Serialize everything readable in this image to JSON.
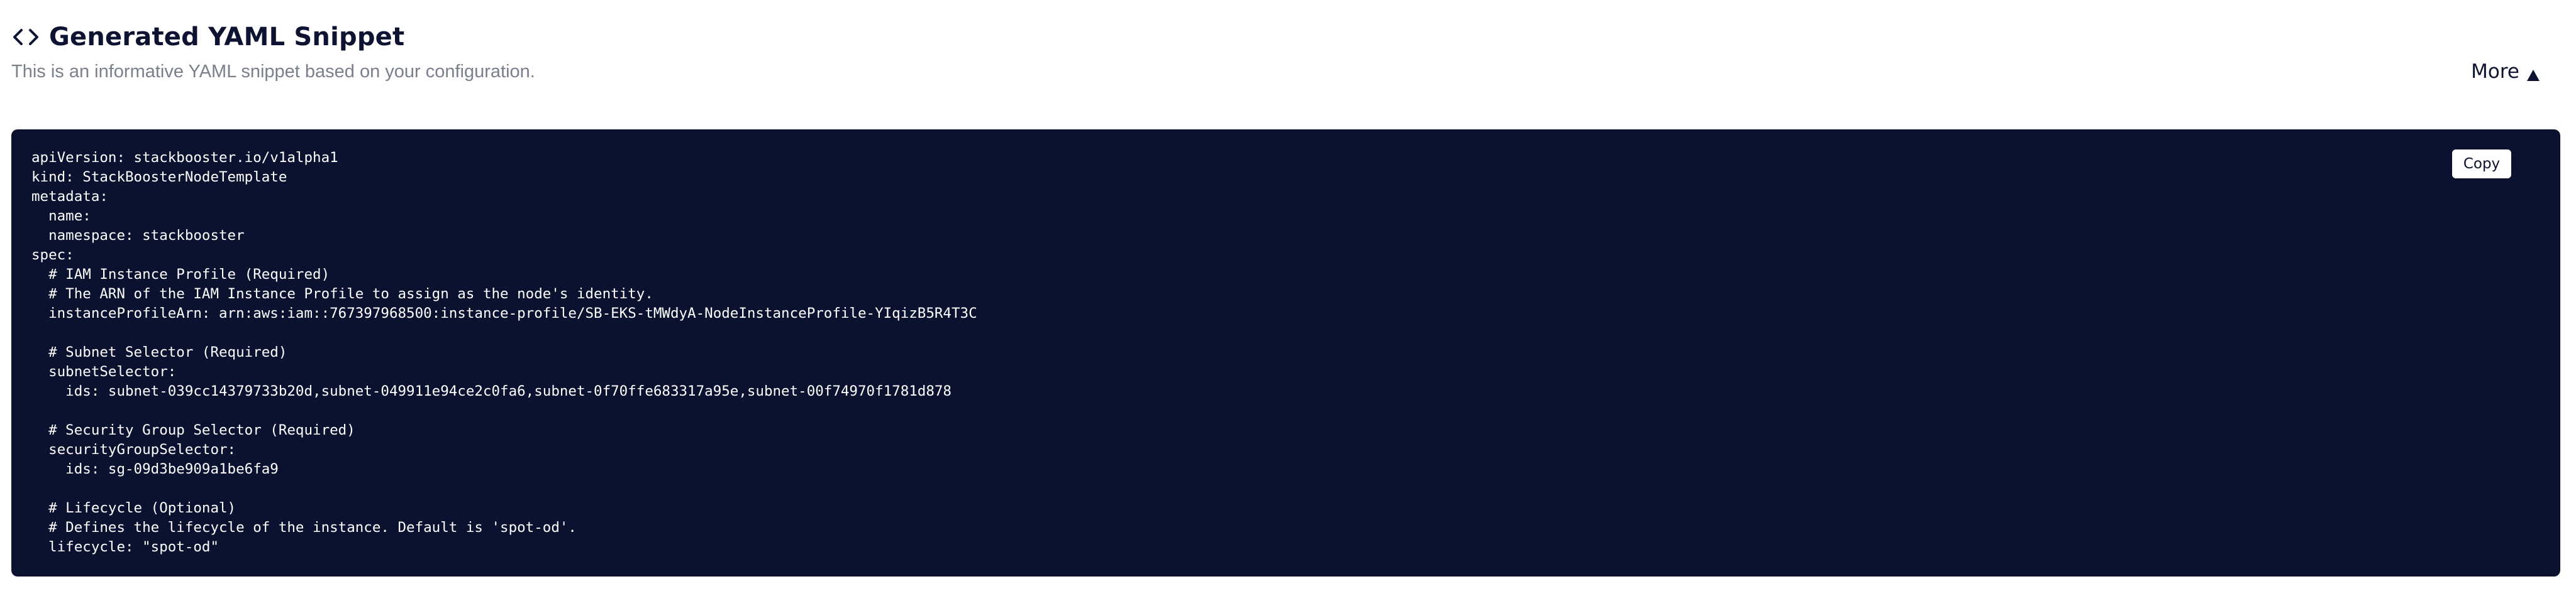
{
  "header": {
    "icon": "code-icon",
    "title": "Generated YAML Snippet",
    "subtitle": "This is an informative YAML snippet based on your configuration."
  },
  "more_toggle": {
    "label": "More",
    "icon": "caret-up-icon"
  },
  "code_panel": {
    "copy_label": "Copy",
    "background": "#0b1230",
    "yaml": "apiVersion: stackbooster.io/v1alpha1\nkind: StackBoosterNodeTemplate\nmetadata:\n  name:\n  namespace: stackbooster\nspec:\n  # IAM Instance Profile (Required)\n  # The ARN of the IAM Instance Profile to assign as the node's identity.\n  instanceProfileArn: arn:aws:iam::767397968500:instance-profile/SB-EKS-tMWdyA-NodeInstanceProfile-YIqizB5R4T3C\n\n  # Subnet Selector (Required)\n  subnetSelector:\n    ids: subnet-039cc14379733b20d,subnet-049911e94ce2c0fa6,subnet-0f70ffe683317a95e,subnet-00f74970f1781d878\n\n  # Security Group Selector (Required)\n  securityGroupSelector:\n    ids: sg-09d3be909a1be6fa9\n\n  # Lifecycle (Optional)\n  # Defines the lifecycle of the instance. Default is 'spot-od'.\n  lifecycle: \"spot-od\""
  }
}
